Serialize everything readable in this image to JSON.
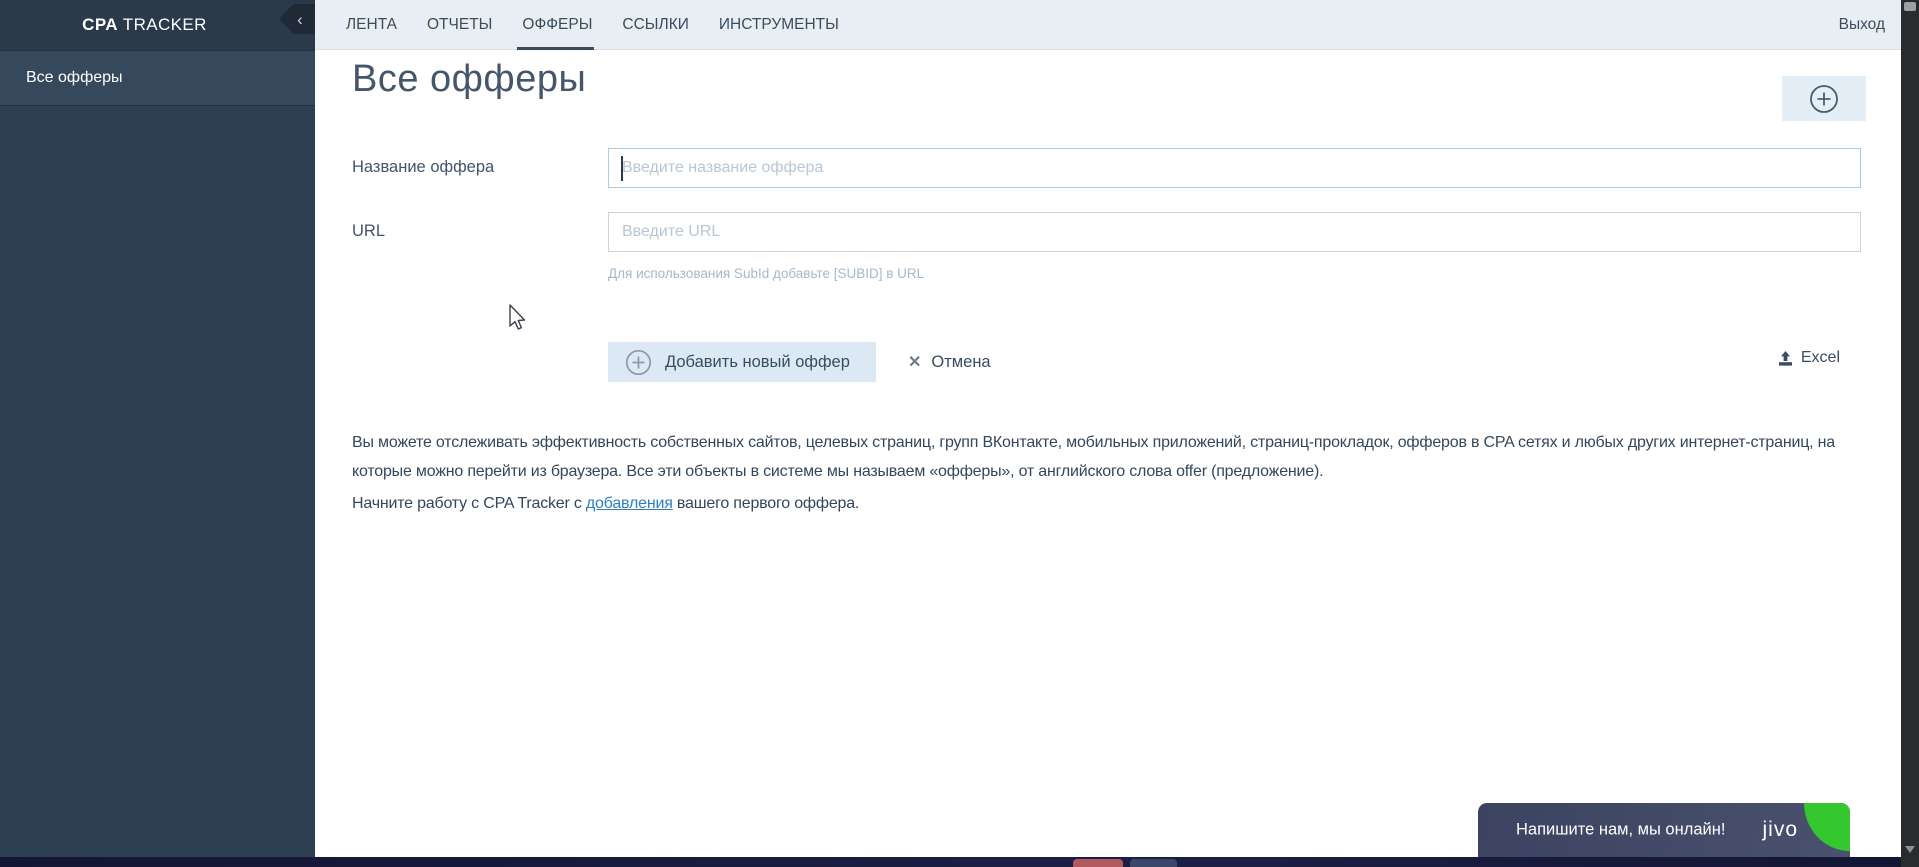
{
  "sidebar": {
    "logo_bold": "CPA",
    "logo_rest": " TRACKER",
    "items": [
      {
        "label": "Все офферы",
        "active": true
      }
    ]
  },
  "topbar": {
    "tabs": [
      {
        "label": "ЛЕНТА",
        "active": false
      },
      {
        "label": "ОТЧЕТЫ",
        "active": false
      },
      {
        "label": "ОФФЕРЫ",
        "active": true
      },
      {
        "label": "ССЫЛКИ",
        "active": false
      },
      {
        "label": "ИНСТРУМЕНТЫ",
        "active": false
      }
    ],
    "logout_label": "Выход"
  },
  "main": {
    "title": "Все офферы",
    "form": {
      "name_label": "Название оффера",
      "name_value": "",
      "name_placeholder": "Введите название оффера",
      "url_label": "URL",
      "url_value": "",
      "url_placeholder": "Введите URL",
      "url_hint": "Для использования SubId добавьте [SUBID] в URL",
      "submit_label": "Добавить новый оффер",
      "cancel_label": "Отмена",
      "excel_label": "Excel"
    },
    "intro_paragraph": "Вы можете отслеживать эффективность собственных сайтов, целевых страниц, групп ВКонтакте, мобильных приложений, страниц-прокладок, офферов в CPA сетях и любых других интернет-страниц, на которые можно перейти из браузера. Все эти объекты в системе мы называем «офферы», от английского слова offer (предложение).",
    "start_prefix": "Начните работу с CPA Tracker с ",
    "start_link": "добавления",
    "start_suffix": " вашего первого оффера."
  },
  "chat_widget": {
    "message": "Напишите нам, мы онлайн!",
    "brand": "jivo"
  },
  "icons": {
    "collapse_chevron": "‹",
    "cancel_x": "✕"
  },
  "colors": {
    "sidebar_header_bg": "#2a3a4b",
    "sidebar_bg": "#2d4052",
    "sidebar_item_active_bg": "#36485b",
    "topbar_bg": "#e9eef4",
    "primary_text": "#3a4d60",
    "focused_input_border": "#a9cbe7",
    "button_bg": "#dce9f5",
    "link": "#2e7fc1",
    "jivo_bg": "#424a66",
    "jivo_green": "#35c72f",
    "taskbar_bg": "#151836"
  }
}
